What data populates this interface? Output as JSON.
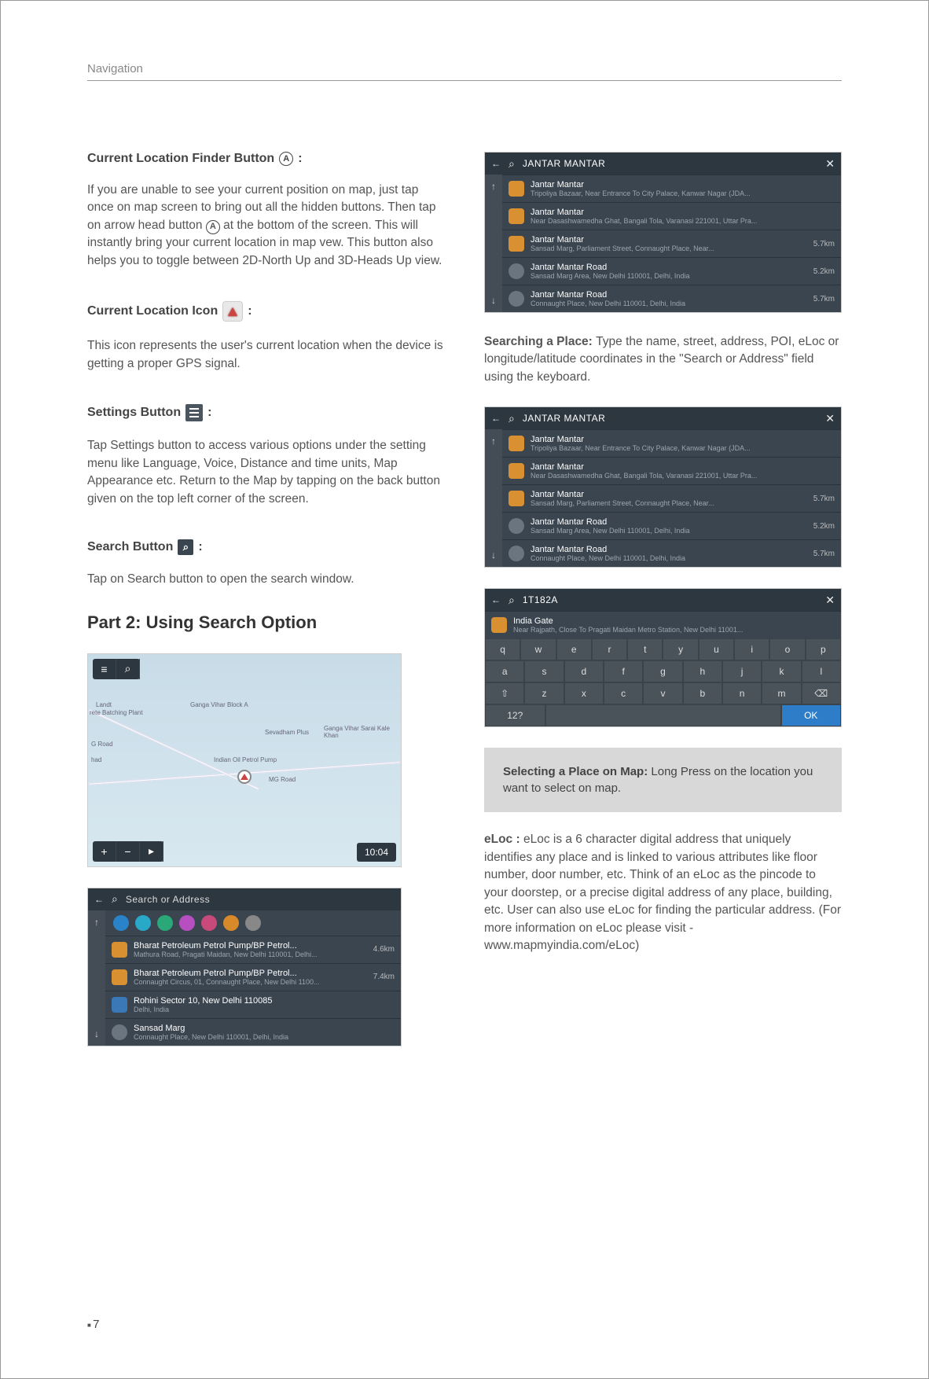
{
  "header": "Navigation",
  "page_number": "7",
  "left": {
    "s1_title": "Current Location Finder Button",
    "s1_body_a": "If you are unable to see your current position on map, just tap once on map screen to bring out all the hidden buttons. Then tap on arrow head button ",
    "s1_body_b": " at the bottom of the screen. This will instantly bring your current location in map vew. This button also helps you to toggle between 2D-North Up and 3D-Heads Up view.",
    "s2_title": "Current Location Icon",
    "s2_body": "This icon represents the user's current location when the device is getting a proper GPS signal.",
    "s3_title": "Settings Button",
    "s3_body": "Tap Settings button to access various options under the setting menu like Language, Voice, Distance and time units, Map Appearance etc. Return to the Map by tapping on the back button given on the top left corner of the screen.",
    "s4_title": "Search Button",
    "s4_body": "Tap on Search button to open the search window.",
    "part2_title": "Part 2: Using Search Option",
    "map": {
      "labels": [
        "Landt",
        "rete Batching Plant",
        "Ganga Vihar Block A",
        "Sevadham Plus",
        "Ganga Vihar Sarai Kale Khan",
        "G Road",
        "had",
        "Indian Oil Petrol Pump",
        "MG Road"
      ],
      "time": "10:04"
    },
    "search_placeholder": "Search or Address",
    "cat_colors": [
      "#2a82c8",
      "#2aa8c8",
      "#2aa878",
      "#b84fc0",
      "#c84a7a",
      "#d88a2a",
      "#888"
    ],
    "nearby": [
      {
        "t1": "Bharat Petroleum Petrol Pump/BP Petrol...",
        "t2": "Mathura Road, Pragati Maidan, New Delhi 110001, Delhi...",
        "d": "4.6km"
      },
      {
        "t1": "Bharat Petroleum Petrol Pump/BP Petrol...",
        "t2": "Connaught Circus, 01, Connaught Place, New Delhi 1100...",
        "d": "7.4km"
      },
      {
        "t1": "Rohini Sector 10, New Delhi 110085",
        "t2": "Delhi, India",
        "d": ""
      },
      {
        "t1": "Sansad Marg",
        "t2": "Connaught Place, New Delhi 110001, Delhi, India",
        "d": ""
      }
    ]
  },
  "right": {
    "search_query": "JANTAR MANTAR",
    "results": [
      {
        "t1": "Jantar Mantar",
        "t2": "Tripoliya Bazaar, Near Entrance To City Palace, Kanwar Nagar (JDA...",
        "d": ""
      },
      {
        "t1": "Jantar Mantar",
        "t2": "Near Dasashwamedha Ghat, Bangali Tola, Varanasi 221001, Uttar Pra...",
        "d": ""
      },
      {
        "t1": "Jantar Mantar",
        "t2": "Sansad Marg, Parliament Street, Connaught Place, Near...",
        "d": "5.7km"
      },
      {
        "t1": "Jantar Mantar Road",
        "t2": "Sansad Marg Area, New Delhi 110001, Delhi, India",
        "d": "5.2km"
      },
      {
        "t1": "Jantar Mantar Road",
        "t2": "Connaught Place, New Delhi 110001, Delhi, India",
        "d": "5.7km"
      }
    ],
    "searching_label": "Searching a Place: ",
    "searching_body": "Type the name, street, address, POI, eLoc or longitude/latitude coordinates in the \"Search or Address\" field using the keyboard.",
    "eloc_query": "1T182A",
    "eloc_result": {
      "t1": "India Gate",
      "t2": "Near Rajpath, Close To Pragati Maidan Metro Station, New Delhi 11001..."
    },
    "kbd_rows": [
      [
        "q",
        "w",
        "e",
        "r",
        "t",
        "y",
        "u",
        "i",
        "o",
        "p"
      ],
      [
        "a",
        "s",
        "d",
        "f",
        "g",
        "h",
        "j",
        "k",
        "l"
      ],
      [
        "⇧",
        "z",
        "x",
        "c",
        "v",
        "b",
        "n",
        "m",
        "⌫"
      ]
    ],
    "kbd_123": "12?",
    "kbd_ok": "OK",
    "tip_label": "Selecting a Place on Map: ",
    "tip_body": "Long Press on the location you want to select on map.",
    "eloc_label": "eLoc : ",
    "eloc_body": "eLoc is a 6 character digital address that uniquely identifies any place and is linked to various attributes like floor number, door number, etc. Think of an eLoc as the pincode to your doorstep, or a precise digital address of any place, building, etc. User can also use eLoc for finding the particular address. (For more information on eLoc please visit - www.mapmyindia.com/eLoc)"
  }
}
